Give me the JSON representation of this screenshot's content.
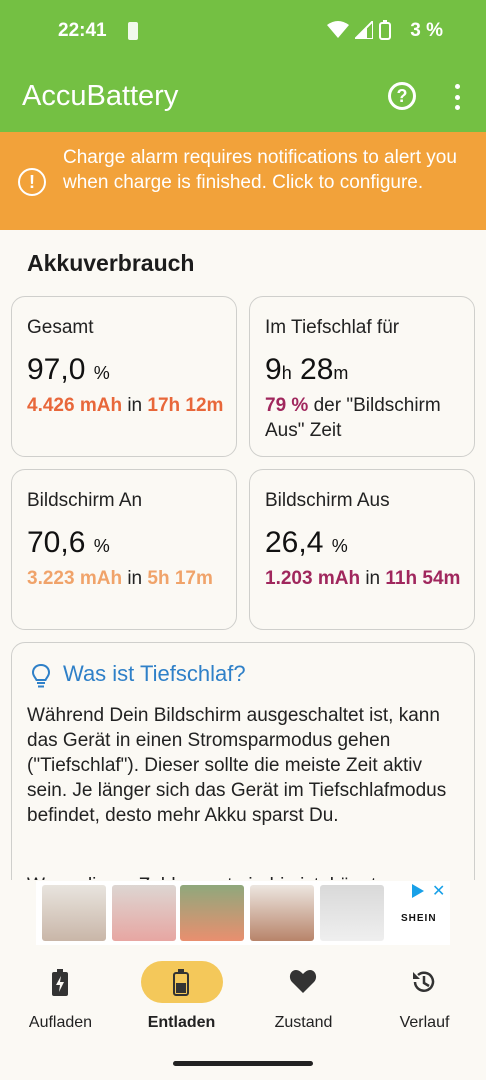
{
  "status_bar": {
    "time": "22:41",
    "battery_percent": "3 %"
  },
  "app_bar": {
    "title": "AccuBattery",
    "help_icon": "help-circle-icon",
    "more_icon": "more-vert-icon"
  },
  "alert": {
    "text": "Charge alarm requires notifications to alert you when charge is finished. Click to configure."
  },
  "section_title": "Akkuverbrauch",
  "cards": {
    "total": {
      "label": "Gesamt",
      "value": "97,0",
      "unit": "%",
      "mah": "4.426 mAh",
      "in": " in ",
      "time": "17h 12m"
    },
    "deepsleep": {
      "label": "Im Tiefschlaf für",
      "hours": "9",
      "h": "h",
      "minutes": "28",
      "m": "m",
      "pct": "79 %",
      "rest": " der \"Bildschirm Aus\" Zeit"
    },
    "screen_on": {
      "label": "Bildschirm An",
      "value": "70,6",
      "unit": "%",
      "mah": "3.223 mAh",
      "in": " in ",
      "time": "5h 17m"
    },
    "screen_off": {
      "label": "Bildschirm Aus",
      "value": "26,4",
      "unit": "%",
      "mah": "1.203 mAh",
      "in": " in ",
      "time": "11h 54m"
    }
  },
  "info": {
    "title": "Was ist Tiefschlaf?",
    "body": "Während Dein Bildschirm ausgeschaltet ist, kann das Gerät in einen Stromsparmodus gehen (\"Tiefschlaf\"). Dieser sollte die meiste Zeit aktiv sein. Je länger sich das Gerät im Tiefschlafmodus befindet, desto mehr Akku sparst Du.",
    "more": "Wenn dieser Zahlenwert niedrig ist, könnte..."
  },
  "ad": {
    "brand": "SHEIN"
  },
  "nav": {
    "items": [
      {
        "label": "Aufladen",
        "icon": "battery-charging-icon"
      },
      {
        "label": "Entladen",
        "icon": "battery-discharging-icon",
        "active": true
      },
      {
        "label": "Zustand",
        "icon": "heart-icon"
      },
      {
        "label": "Verlauf",
        "icon": "history-icon"
      }
    ]
  },
  "colors": {
    "primary": "#74c043",
    "alert": "#f2a23a",
    "accent_orange": "#e8673a",
    "accent_light_orange": "#f0a36a",
    "accent_maroon": "#a0275d",
    "link_blue": "#2f80c8",
    "nav_active": "#f4c85a"
  }
}
